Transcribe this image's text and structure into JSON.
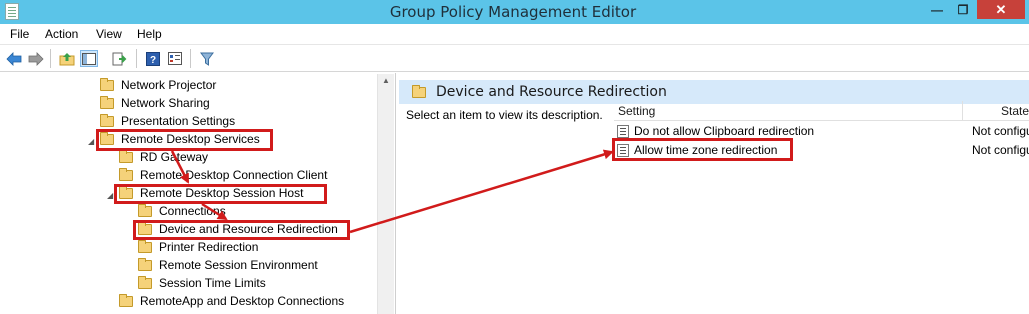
{
  "window": {
    "title": "Group Policy Management Editor",
    "minimize_glyph": "—",
    "maximize_glyph": "❐",
    "close_glyph": "✕"
  },
  "menu": [
    "File",
    "Action",
    "View",
    "Help"
  ],
  "toolbar": {
    "icons": [
      "back-arrow-icon",
      "forward-arrow-icon",
      "up-folder-icon",
      "show-hide-tree-icon",
      "export-list-icon",
      "help-icon",
      "properties-icon",
      "filter-icon"
    ]
  },
  "tree": {
    "items": [
      {
        "label": "Network Projector"
      },
      {
        "label": "Network Sharing"
      },
      {
        "label": "Presentation Settings"
      },
      {
        "label": "Remote Desktop Services",
        "expanded": true,
        "highlighted": true
      },
      {
        "label": "RD Gateway"
      },
      {
        "label": "Remote Desktop Connection Client"
      },
      {
        "label": "Remote Desktop Session Host",
        "expanded": true,
        "highlighted": true
      },
      {
        "label": "Connections"
      },
      {
        "label": "Device and Resource Redirection",
        "selected": true,
        "highlighted": true
      },
      {
        "label": "Printer Redirection"
      },
      {
        "label": "Remote Session Environment"
      },
      {
        "label": "Session Time Limits"
      },
      {
        "label": "RemoteApp and Desktop Connections"
      }
    ]
  },
  "details": {
    "title": "Device and Resource Redirection",
    "description": "Select an item to view its description.",
    "columns": {
      "setting": "Setting",
      "state": "State"
    },
    "rows": [
      {
        "setting": "Do not allow Clipboard redirection",
        "state": "Not configured"
      },
      {
        "setting": "Allow time zone redirection",
        "state": "Not configured",
        "highlighted": true
      }
    ]
  },
  "colors": {
    "titlebar": "#5bc4e8",
    "annotation_red": "#d11b1b",
    "details_header": "#d6e9fa",
    "folder": "#f5d27a"
  }
}
